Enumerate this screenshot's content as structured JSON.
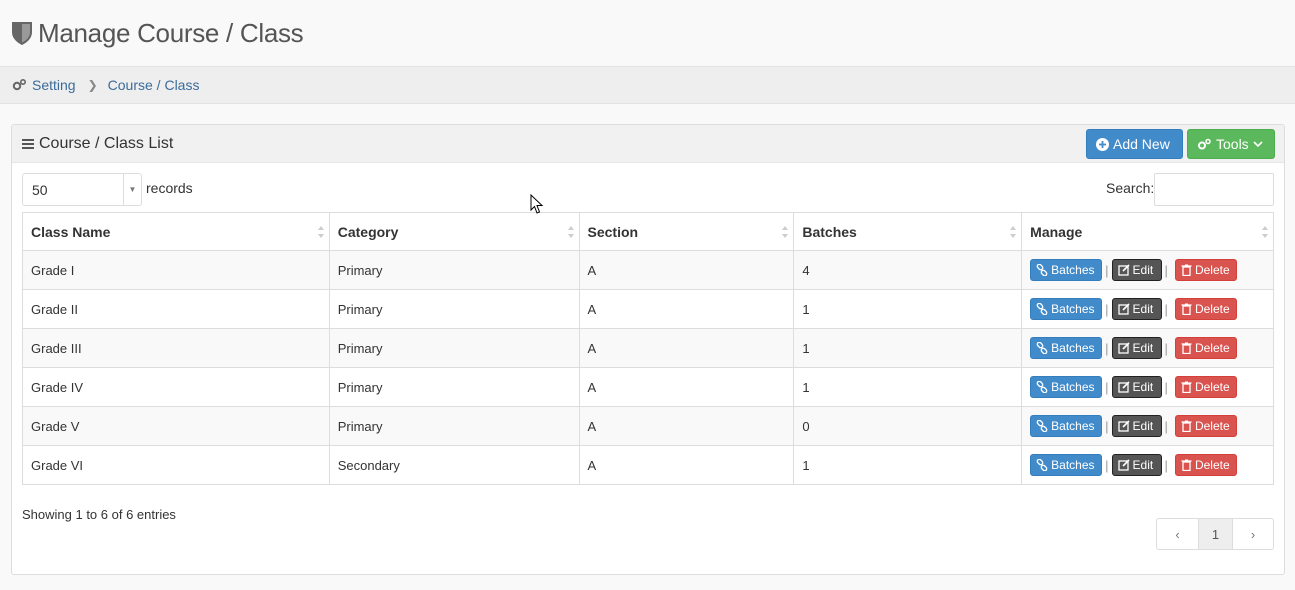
{
  "header": {
    "title": "Manage Course / Class",
    "icon": "shield-icon"
  },
  "breadcrumb": {
    "items": [
      "Setting",
      "Course / Class"
    ]
  },
  "panel": {
    "title": "Course / Class List",
    "add_label": "Add New",
    "tools_label": "Tools"
  },
  "controls": {
    "length_value": "50",
    "length_label": "records",
    "search_label": "Search:",
    "search_value": ""
  },
  "table": {
    "columns": [
      "Class Name",
      "Category",
      "Section",
      "Batches",
      "Manage"
    ],
    "rows": [
      {
        "name": "Grade I",
        "category": "Primary",
        "section": "A",
        "batches": "4"
      },
      {
        "name": "Grade II",
        "category": "Primary",
        "section": "A",
        "batches": "1"
      },
      {
        "name": "Grade III",
        "category": "Primary",
        "section": "A",
        "batches": "1"
      },
      {
        "name": "Grade IV",
        "category": "Primary",
        "section": "A",
        "batches": "1"
      },
      {
        "name": "Grade V",
        "category": "Primary",
        "section": "A",
        "batches": "0"
      },
      {
        "name": "Grade VI",
        "category": "Secondary",
        "section": "A",
        "batches": "1"
      }
    ],
    "actions": {
      "batches": "Batches",
      "edit": "Edit",
      "delete": "Delete"
    }
  },
  "footer": {
    "info": "Showing 1 to 6 of 6 entries",
    "page": "1"
  },
  "colors": {
    "primary": "#428bca",
    "success": "#5cb85c",
    "danger": "#d9534f",
    "dark": "#555555",
    "link": "#3a6c9b"
  }
}
